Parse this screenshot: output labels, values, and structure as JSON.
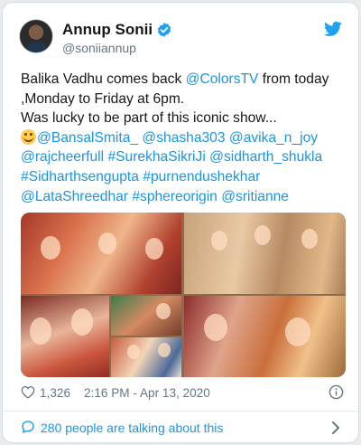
{
  "colors": {
    "accent": "#1b95e0",
    "secondary_text": "#657786",
    "text": "#14171a",
    "verified": "#1da1f2"
  },
  "author": {
    "name": "Annup Sonii",
    "handle": "@soniiannup",
    "verified_icon": "verified-badge-icon",
    "platform_icon": "twitter-bird-icon"
  },
  "tweet": {
    "lines": [
      [
        {
          "t": "Balika Vadhu comes back "
        },
        {
          "t": "@ColorsTV",
          "link": true
        },
        {
          "t": " from today"
        }
      ],
      [
        {
          "t": ",Monday to Friday at 6pm."
        }
      ],
      [
        {
          "t": "Was lucky to be part of this iconic show..."
        }
      ],
      [
        {
          "emoji": "smiling-face-icon"
        },
        {
          "t": "@BansalSmita_",
          "link": true
        },
        {
          "t": " "
        },
        {
          "t": "@shasha303",
          "link": true
        },
        {
          "t": " "
        },
        {
          "t": "@avika_n_joy",
          "link": true
        }
      ],
      [
        {
          "t": "@rajcheerfull",
          "link": true
        },
        {
          "t": " "
        },
        {
          "t": "#SurekhaSikriJi",
          "link": true
        },
        {
          "t": " "
        },
        {
          "t": "@sidharth_shukla",
          "link": true
        }
      ],
      [
        {
          "t": "#Sidharthsengupta",
          "link": true
        },
        {
          "t": " "
        },
        {
          "t": "#purnendushekhar",
          "link": true
        }
      ],
      [
        {
          "t": "@LataShreedhar",
          "link": true
        },
        {
          "t": " "
        },
        {
          "t": "#sphereorigin",
          "link": true
        },
        {
          "t": " "
        },
        {
          "t": "@sritianne",
          "link": true
        }
      ]
    ]
  },
  "media": {
    "photos": [
      "cast-photo-couple",
      "cast-photo-family",
      "cast-photo-bride-groom",
      "cast-photo-group-green",
      "cast-photo-group-blue",
      "cast-photo-smiling-couple"
    ]
  },
  "meta": {
    "likes": "1,326",
    "timestamp": "2:16 PM - Apr 13, 2020",
    "like_icon": "heart-icon",
    "info_icon": "info-icon"
  },
  "conversation": {
    "label": "280 people are talking about this",
    "icon": "speech-bubble-icon",
    "chevron_icon": "chevron-right-icon"
  }
}
